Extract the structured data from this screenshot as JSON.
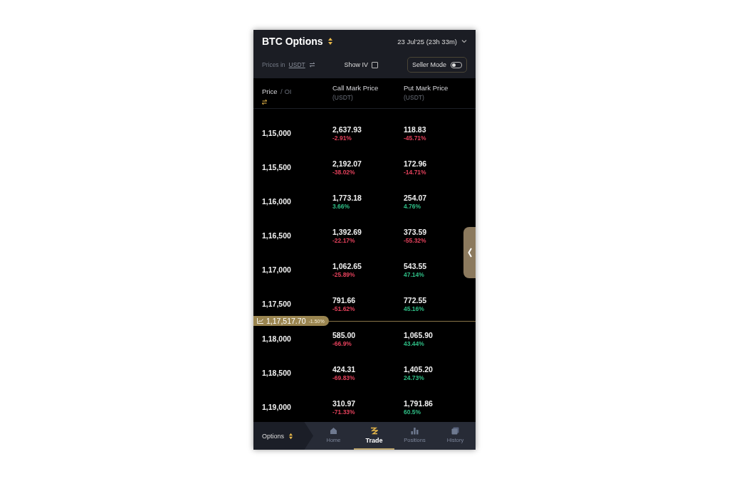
{
  "header": {
    "title": "BTC Options",
    "expiry": "23 Jul'25 (23h 33m)"
  },
  "settings": {
    "prices_in_label": "Prices in",
    "currency": "USDT",
    "show_iv_label": "Show IV",
    "show_iv_checked": false,
    "seller_mode_label": "Seller Mode",
    "seller_mode_on": false
  },
  "columns": [
    {
      "title": "Price",
      "title_2": "/ OI"
    },
    {
      "title": "Call Mark Price",
      "unit": "(USDT)"
    },
    {
      "title": "Put Mark Price",
      "unit": "(USDT)"
    }
  ],
  "rows": [
    {
      "kind": "strike",
      "strike": "1,15,000",
      "call": {
        "price": "2,637.93",
        "change": "-2.91%",
        "color": "#e0405a"
      },
      "put": {
        "price": "118.83",
        "change": "-45.71%",
        "color": "#e0405a"
      }
    },
    {
      "kind": "strike",
      "strike": "1,15,500",
      "call": {
        "price": "2,192.07",
        "change": "-38.02%",
        "color": "#e0405a"
      },
      "put": {
        "price": "172.96",
        "change": "-14.71%",
        "color": "#e0405a"
      }
    },
    {
      "kind": "strike",
      "strike": "1,16,000",
      "call": {
        "price": "1,773.18",
        "change": "3.66%",
        "color": "#2ebd85"
      },
      "put": {
        "price": "254.07",
        "change": "4.76%",
        "color": "#2ebd85"
      }
    },
    {
      "kind": "strike",
      "strike": "1,16,500",
      "call": {
        "price": "1,392.69",
        "change": "-22.17%",
        "color": "#e0405a"
      },
      "put": {
        "price": "373.59",
        "change": "-55.32%",
        "color": "#e0405a"
      }
    },
    {
      "kind": "strike",
      "strike": "1,17,000",
      "call": {
        "price": "1,062.65",
        "change": "-25.89%",
        "color": "#e0405a"
      },
      "put": {
        "price": "543.55",
        "change": "47.14%",
        "color": "#2ebd85"
      }
    },
    {
      "kind": "strike",
      "strike": "1,17,500",
      "call": {
        "price": "791.66",
        "change": "-51.62%",
        "color": "#e0405a"
      },
      "put": {
        "price": "772.55",
        "change": "45.16%",
        "color": "#2ebd85"
      }
    },
    {
      "kind": "index_price",
      "price": "1,17,517.70",
      "change": "-1.50%"
    },
    {
      "kind": "strike",
      "strike": "1,18,000",
      "call": {
        "price": "585.00",
        "change": "-66.9%",
        "color": "#e0405a"
      },
      "put": {
        "price": "1,065.90",
        "change": "43.44%",
        "color": "#2ebd85"
      }
    },
    {
      "kind": "strike",
      "strike": "1,18,500",
      "call": {
        "price": "424.31",
        "change": "-69.83%",
        "color": "#e0405a"
      },
      "put": {
        "price": "1,405.20",
        "change": "24.73%",
        "color": "#2ebd85"
      }
    },
    {
      "kind": "strike",
      "strike": "1,19,000",
      "call": {
        "price": "310.97",
        "change": "-71.33%",
        "color": "#e0405a"
      },
      "put": {
        "price": "1,791.86",
        "change": "60.5%",
        "color": "#2ebd85"
      }
    }
  ],
  "bottom_nav": {
    "product": "Options",
    "tabs": [
      {
        "label": "Home",
        "selected": false
      },
      {
        "label": "Trade",
        "selected": true
      },
      {
        "label": "Positions",
        "selected": false
      },
      {
        "label": "History",
        "selected": false
      }
    ]
  }
}
